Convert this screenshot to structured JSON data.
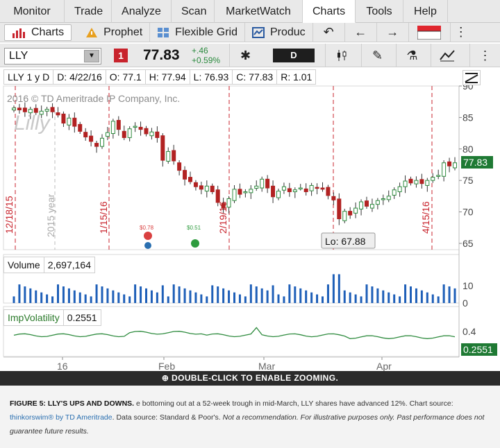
{
  "menu": [
    "Monitor",
    "Trade",
    "Analyze",
    "Scan",
    "MarketWatch",
    "Charts",
    "Tools",
    "Help"
  ],
  "subtoolbar": {
    "charts": "Charts",
    "prophet": "Prophet",
    "flexible_grid": "Flexible Grid",
    "product": "Produc"
  },
  "symbol_bar": {
    "symbol": "LLY",
    "link": "1",
    "last": "77.83",
    "change": "+.46",
    "change_pct": "+0.59%",
    "aggregation": "D"
  },
  "info_bar": {
    "title": "LLY 1 y D",
    "date": "D: 4/22/16",
    "open": "O: 77.1",
    "high": "H: 77.94",
    "low": "L: 76.93",
    "close": "C: 77.83",
    "range": "R: 1.01"
  },
  "watermark": "2016 © TD Ameritrade IP Company, Inc.",
  "price_axis": {
    "ticks": [
      "90",
      "85",
      "80",
      "75",
      "70",
      "65"
    ]
  },
  "last_price_label": "77.83",
  "low_label": "Lo: 67.88",
  "date_markers": [
    "12/18/15",
    "2015 year",
    "1/15/16",
    "2/19/16",
    "4/15/16"
  ],
  "dividend_events": [
    {
      "amount": "$0.78"
    },
    {
      "amount": "$0.51"
    }
  ],
  "volume_panel": {
    "label": "Volume",
    "value": "2,697,164",
    "tick": "10"
  },
  "iv_panel": {
    "label": "ImpVolatility",
    "value": "0.2551",
    "tick": "0.4",
    "badge": "0.2551"
  },
  "x_axis": [
    "16",
    "Feb",
    "Mar",
    "Apr"
  ],
  "zoom_hint": "DOUBLE-CLICK TO ENABLE ZOOMING.",
  "caption": {
    "title": "FIGURE 5: LLY'S UPS AND DOWNS.",
    "text1": "e bottoming out at a 52-week trough in mid-March, LLY shares have advanced 12%. Chart source:",
    "source": "thinkorswim® by TD Ameritrade",
    "text2": "Data source: Standard & Poor's.",
    "italic": "Not a recommendation. For illustrative purposes only. Past performance does not guarantee future results."
  },
  "chart_data": {
    "type": "candlestick",
    "symbol": "LLY",
    "closes": [
      86.5,
      86.2,
      85.9,
      86.3,
      85.8,
      86.0,
      86.3,
      85.9,
      85.4,
      84.1,
      84.9,
      83.6,
      82.8,
      81.9,
      81.2,
      80.4,
      81.7,
      82.6,
      84.4,
      83.1,
      81.8,
      83.2,
      83.6,
      83.1,
      82.4,
      82.7,
      81.8,
      78.2,
      79.6,
      78.1,
      76.6,
      75.2,
      74.8,
      74.0,
      73.6,
      74.1,
      73.2,
      71.5,
      70.6,
      72.1,
      73.6,
      72.8,
      73.2,
      73.6,
      74.1,
      75.2,
      73.8,
      72.4,
      73.3,
      74.0,
      73.2,
      73.5,
      73.8,
      73.2,
      74.2,
      73.8,
      73.6,
      72.6,
      71.9,
      68.9,
      70.1,
      69.5,
      70.6,
      71.6,
      70.9,
      71.2,
      71.8,
      72.1,
      72.5,
      73.5,
      74.0,
      74.9,
      74.6,
      75.0,
      74.5,
      75.0,
      75.5,
      75.8,
      77.8,
      77.3,
      77.8
    ],
    "price_range": [
      64,
      90
    ],
    "volume_max": 15,
    "iv_range": [
      0.1,
      0.5
    ]
  }
}
